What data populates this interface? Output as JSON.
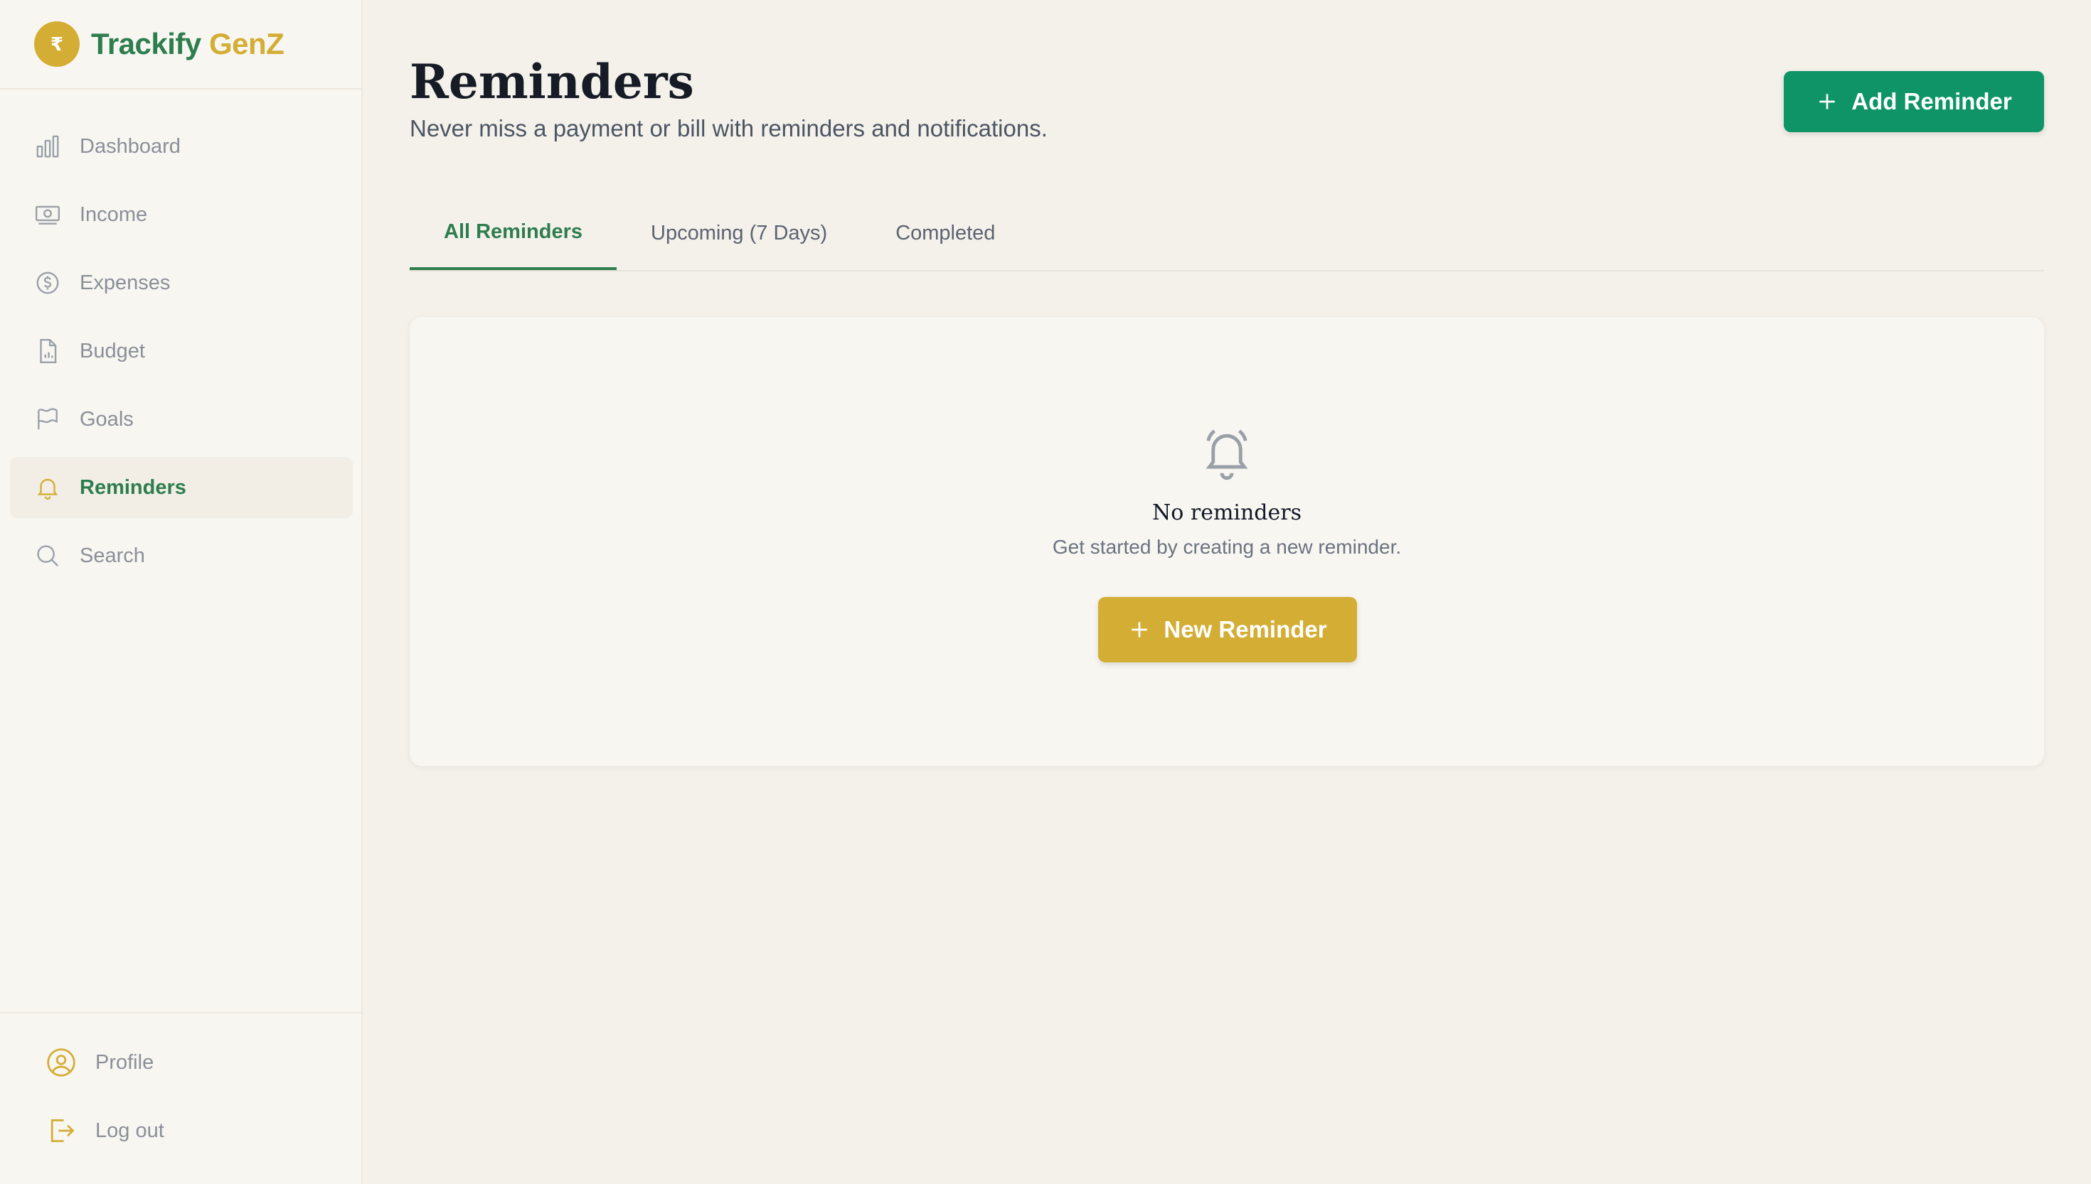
{
  "brand": {
    "logo_glyph": "₹",
    "name_part1": "Trackify",
    "name_part2": "GenZ",
    "primary_color": "#2e7d4f",
    "accent_color": "#d4ad34"
  },
  "sidebar": {
    "items": [
      {
        "label": "Dashboard",
        "icon": "bar-chart-icon",
        "active": false
      },
      {
        "label": "Income",
        "icon": "banknote-icon",
        "active": false
      },
      {
        "label": "Expenses",
        "icon": "dollar-circle-icon",
        "active": false
      },
      {
        "label": "Budget",
        "icon": "document-chart-icon",
        "active": false
      },
      {
        "label": "Goals",
        "icon": "flag-icon",
        "active": false
      },
      {
        "label": "Reminders",
        "icon": "bell-icon",
        "active": true
      },
      {
        "label": "Search",
        "icon": "search-icon",
        "active": false
      }
    ],
    "bottom": [
      {
        "label": "Profile",
        "icon": "user-circle-icon"
      },
      {
        "label": "Log out",
        "icon": "logout-icon"
      }
    ]
  },
  "header": {
    "title": "Reminders",
    "subtitle": "Never miss a payment or bill with reminders and notifications.",
    "add_button_label": "Add Reminder",
    "add_button_color": "#0e9467"
  },
  "tabs": [
    {
      "label": "All Reminders",
      "active": true
    },
    {
      "label": "Upcoming (7 Days)",
      "active": false
    },
    {
      "label": "Completed",
      "active": false
    }
  ],
  "empty_state": {
    "icon": "bell-icon",
    "title": "No reminders",
    "text": "Get started by creating a new reminder.",
    "button_label": "New Reminder",
    "button_color": "#d4ad34"
  }
}
